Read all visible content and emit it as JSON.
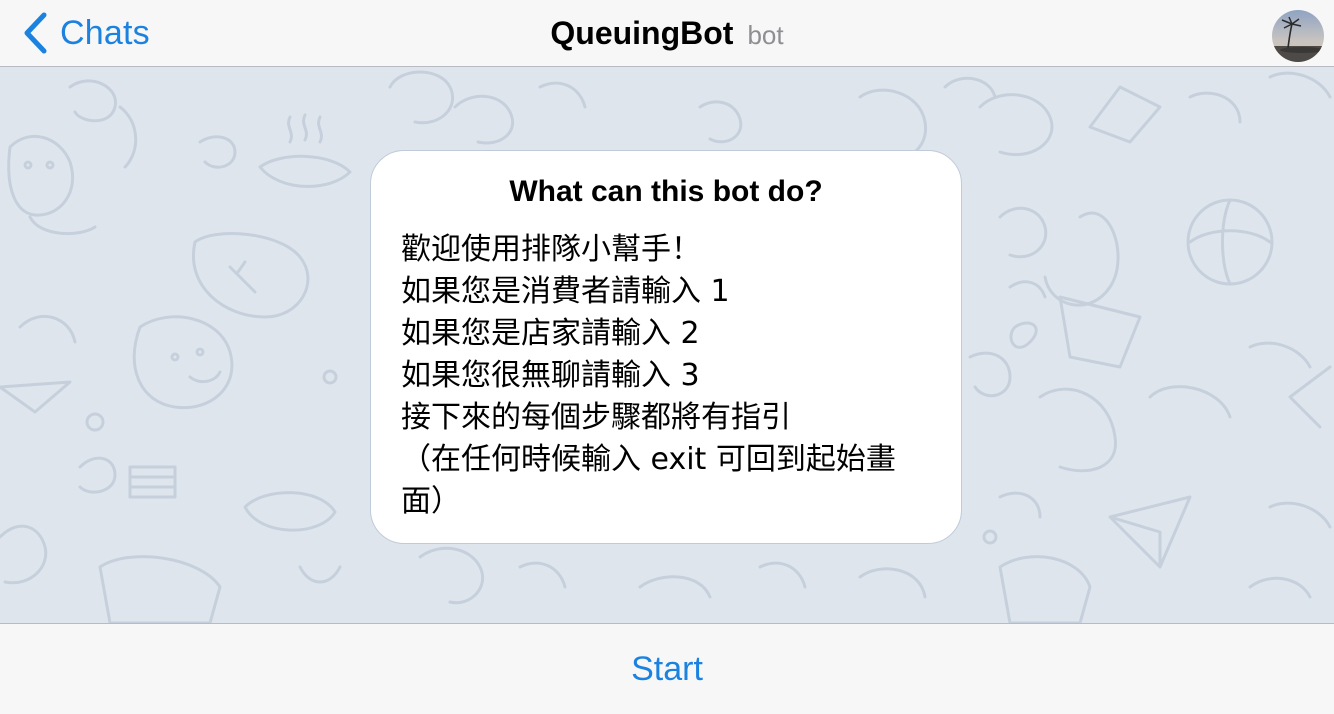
{
  "navbar": {
    "back_label": "Chats",
    "title": "QueuingBot",
    "subtitle": "bot"
  },
  "info_bubble": {
    "title": "What can this bot do?",
    "lines": [
      "歡迎使用排隊小幫手！",
      "如果您是消費者請輸入 1",
      "如果您是店家請輸入 2",
      "如果您很無聊請輸入 3",
      "接下來的每個步驟都將有指引",
      "（在任何時候輸入 exit 可回到起始畫",
      "面）"
    ]
  },
  "bottom_bar": {
    "start_label": "Start"
  },
  "colors": {
    "accent": "#1b82e0",
    "chat_background": "#dfe5ec",
    "bar_background": "#f7f7f7",
    "subtitle_gray": "#8e8e93"
  },
  "icons": {
    "back": "chevron-left-icon",
    "avatar": "beach-palm-avatar"
  }
}
